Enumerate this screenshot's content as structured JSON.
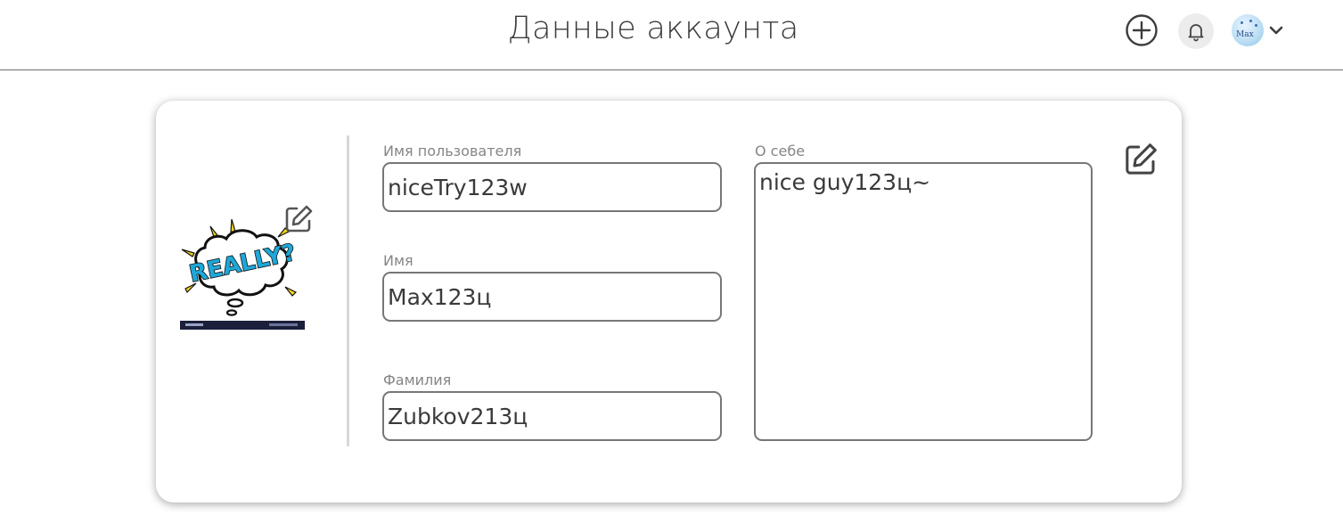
{
  "header": {
    "title": "Данные аккаунта",
    "add_icon": "plus-circle-icon",
    "bell_icon": "bell-icon",
    "avatar_text": "Max",
    "menu_icon": "chevron-down-icon"
  },
  "profile": {
    "photo": {
      "sticker_text": "REALLY?",
      "edit_icon": "pencil-square-icon"
    },
    "fields": {
      "username": {
        "label": "Имя пользователя",
        "value": "niceTry123w"
      },
      "first_name": {
        "label": "Имя",
        "value": "Max123ц"
      },
      "last_name": {
        "label": "Фамилия",
        "value": "Zubkov213ц"
      },
      "about": {
        "label": "О себе",
        "value": "nice guy123ц~"
      }
    },
    "edit_icon": "pencil-square-icon"
  },
  "colors": {
    "border": "#777777",
    "label": "#858585",
    "sticker_blue": "#1ea7d8",
    "sticker_yellow": "#f5d31a"
  }
}
